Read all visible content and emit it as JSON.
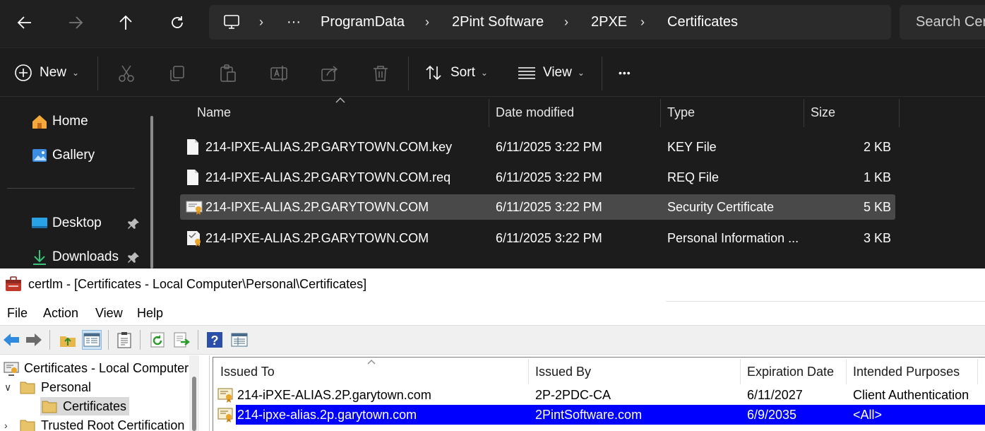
{
  "explorer": {
    "breadcrumb": {
      "more": "···",
      "items": [
        "ProgramData",
        "2Pint Software",
        "2PXE",
        "Certificates"
      ]
    },
    "search_placeholder": "Search Certificates",
    "commands": {
      "new_label": "New",
      "sort_label": "Sort",
      "view_label": "View",
      "more_label": "•••"
    },
    "nav": {
      "home": "Home",
      "gallery": "Gallery",
      "desktop": "Desktop",
      "downloads": "Downloads"
    },
    "columns": [
      "Name",
      "Date modified",
      "Type",
      "Size"
    ],
    "files": [
      {
        "name": "214-IPXE-ALIAS.2P.GARYTOWN.COM.key",
        "date": "6/11/2025 3:22 PM",
        "type": "KEY File",
        "size": "2 KB",
        "icon": "file-icon"
      },
      {
        "name": "214-IPXE-ALIAS.2P.GARYTOWN.COM.req",
        "date": "6/11/2025 3:22 PM",
        "type": "REQ File",
        "size": "1 KB",
        "icon": "file-icon"
      },
      {
        "name": "214-IPXE-ALIAS.2P.GARYTOWN.COM",
        "date": "6/11/2025 3:22 PM",
        "type": "Security Certificate",
        "size": "5 KB",
        "icon": "certificate-icon",
        "selected": true
      },
      {
        "name": "214-IPXE-ALIAS.2P.GARYTOWN.COM",
        "date": "6/11/2025 3:22 PM",
        "type": "Personal Information ...",
        "size": "3 KB",
        "icon": "pfx-icon"
      }
    ],
    "colors": {
      "background": "#1c1c1c",
      "selection": "#494949"
    }
  },
  "certlm": {
    "title": "certlm - [Certificates - Local Computer\\Personal\\Certificates]",
    "menu": [
      "File",
      "Action",
      "View",
      "Help"
    ],
    "tree": {
      "root": "Certificates - Local Computer",
      "personal": "Personal",
      "certificates": "Certificates",
      "trusted": "Trusted Root Certification ."
    },
    "columns": [
      "Issued To",
      "Issued By",
      "Expiration Date",
      "Intended Purposes"
    ],
    "rows": [
      {
        "issued_to": "214-iPXE-ALIAS.2P.garytown.com",
        "issued_by": "2P-2PDC-CA",
        "expiration": "6/11/2027",
        "purposes": "Client Authentication"
      },
      {
        "issued_to": "214-ipxe-alias.2p.garytown.com",
        "issued_by": "2PintSoftware.com",
        "expiration": "6/9/2035",
        "purposes": "<All>",
        "selected": true
      }
    ],
    "colors": {
      "selection": "#0000ff"
    }
  }
}
